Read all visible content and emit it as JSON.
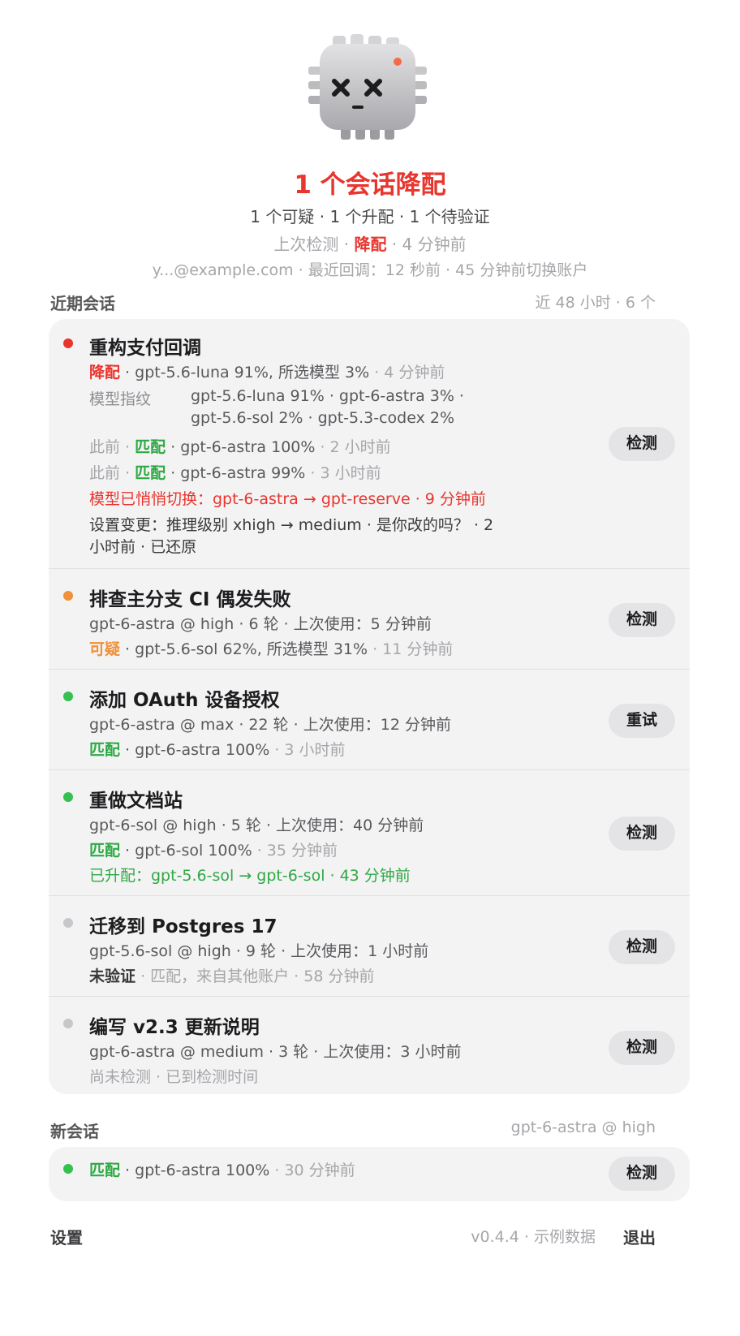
{
  "header": {
    "mascot_icon": "broken-chip-icon",
    "title": "1 个会话降配",
    "summary": "1 个可疑 · 1 个升配 · 1 个待验证",
    "last_check_prefix": "上次检测 · ",
    "last_check_status": "降配",
    "last_check_time": " · 4 分钟前",
    "account_line": "y...@example.com · 最近回调：12 秒前 · 45 分钟前切换账户"
  },
  "recent": {
    "label": "近期会话",
    "meta": "近 48 小时 · 6 个",
    "sessions": [
      {
        "title": "重构支付回调",
        "status_label": "降配",
        "status_detail": " · gpt-5.6-luna 91%, 所选模型 3%",
        "status_time": " · 4 分钟前",
        "fingerprint_label": "模型指纹",
        "fingerprint_line1": "gpt-5.6-luna 91% · gpt-6-astra 3% ·",
        "fingerprint_line2": "gpt-5.6-sol 2% · gpt-5.3-codex 2%",
        "prev1_prefix": "此前 · ",
        "prev1_status": "匹配",
        "prev1_detail": " · gpt-6-astra 100%",
        "prev1_time": " · 2 小时前",
        "prev2_prefix": "此前 · ",
        "prev2_status": "匹配",
        "prev2_detail": " · gpt-6-astra 99%",
        "prev2_time": " · 3 小时前",
        "switch_line": "模型已悄悄切换：gpt-6-astra → gpt-reserve · 9 分钟前",
        "settings_line1": "设置变更：推理级别 xhigh → medium · 是你改的吗？ · 2",
        "settings_line2": "小时前 · 已还原",
        "button": "检测"
      },
      {
        "title": "排查主分支 CI 偶发失败",
        "meta": "gpt-6-astra @ high · 6 轮 · 上次使用：5 分钟前",
        "status_label": "可疑",
        "status_detail": " · gpt-5.6-sol 62%, 所选模型 31%",
        "status_time": " · 11 分钟前",
        "button": "检测"
      },
      {
        "title": "添加 OAuth 设备授权",
        "meta": "gpt-6-astra @ max · 22 轮 · 上次使用：12 分钟前",
        "status_label": "匹配",
        "status_detail": " · gpt-6-astra 100%",
        "status_time": " · 3 小时前",
        "button": "重试"
      },
      {
        "title": "重做文档站",
        "meta": "gpt-6-sol @ high · 5 轮 · 上次使用：40 分钟前",
        "status_label": "匹配",
        "status_detail": " · gpt-6-sol 100%",
        "status_time": " · 35 分钟前",
        "upgrade_line": "已升配：gpt-5.6-sol → gpt-6-sol · 43 分钟前",
        "button": "检测"
      },
      {
        "title": "迁移到 Postgres 17",
        "meta": "gpt-5.6-sol @ high · 9 轮 · 上次使用：1 小时前",
        "status_label": "未验证",
        "status_detail": " · 匹配，来自其他账户 · 58 分钟前",
        "button": "检测"
      },
      {
        "title": "编写 v2.3 更新说明",
        "meta": "gpt-6-astra @ medium · 3 轮 · 上次使用：3 小时前",
        "status_text": "尚未检测 · 已到检测时间",
        "button": "检测"
      }
    ]
  },
  "new_session": {
    "label": "新会话",
    "meta": "gpt-6-astra @ high",
    "status_label": "匹配",
    "status_detail": " · gpt-6-astra 100%",
    "status_time": " · 30 分钟前",
    "button": "检测"
  },
  "footer": {
    "settings": "设置",
    "version": "v0.4.4 · 示例数据",
    "quit": "退出"
  },
  "colors": {
    "downgrade": "#e8352d",
    "match": "#2fa944",
    "suspicious": "#f0903a",
    "card_bg": "#f3f3f4"
  }
}
